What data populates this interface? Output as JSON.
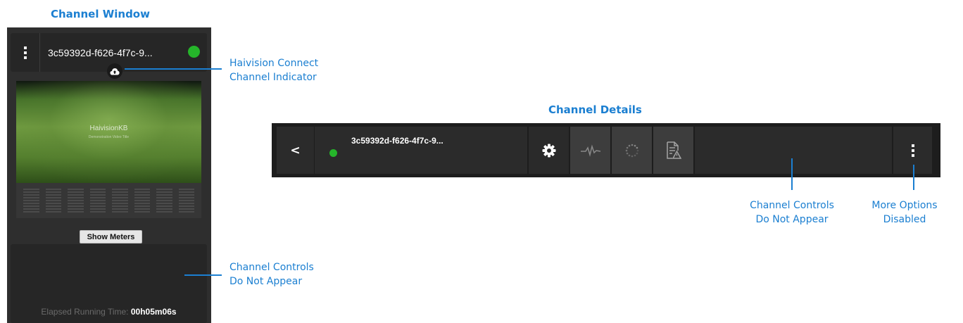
{
  "headings": {
    "channel_window": "Channel Window",
    "channel_details": "Channel Details"
  },
  "channel_window": {
    "channel_name": "3c59392d-f626-4f7c-9...",
    "status": "online",
    "watermark_title": "HaivisionKB",
    "watermark_subtitle": "Demonstration Video Title",
    "meter_count": 8,
    "show_meters_label": "Show Meters",
    "elapsed_label": "Elapsed Running Time:",
    "elapsed_value": "00h05m06s"
  },
  "channel_details": {
    "back_label": "<",
    "channel_name": "3c59392d-f626-4f7c-9..."
  },
  "icons": {
    "menu": "kebab-menu-icon",
    "cloud": "cloud-upload-icon",
    "settings": "gear-icon",
    "stats": "pulse-icon",
    "loading": "spinner-icon",
    "log": "document-warning-icon"
  },
  "callouts": {
    "haivision_connect": [
      "Haivision Connect",
      "Channel Indicator"
    ],
    "controls_window": [
      "Channel Controls",
      "Do Not Appear"
    ],
    "controls_details": [
      "Channel Controls",
      "Do Not Appear"
    ],
    "more_options": [
      "More Options",
      "Disabled"
    ]
  },
  "colors": {
    "accent_blue": "#1b7fd1",
    "status_green": "#25b52a",
    "panel_dark": "#2e2e2e"
  }
}
